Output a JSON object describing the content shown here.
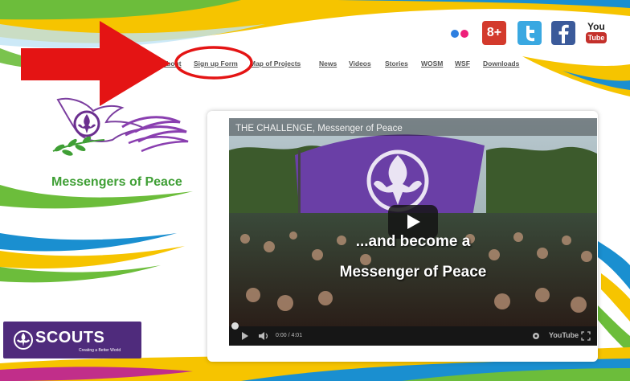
{
  "nav": {
    "items": [
      {
        "label": "About"
      },
      {
        "label": "Sign up Form"
      },
      {
        "label": "Map of Projects"
      },
      {
        "label": "News"
      },
      {
        "label": "Videos"
      },
      {
        "label": "Stories"
      },
      {
        "label": "WOSM"
      },
      {
        "label": "WSF"
      },
      {
        "label": "Downloads"
      }
    ]
  },
  "social": {
    "icons": [
      "flickr-icon",
      "google-plus-icon",
      "twitter-icon",
      "facebook-icon",
      "youtube-icon"
    ],
    "gplus_glyph": "8+",
    "youtube_top": "You",
    "youtube_bottom": "Tube"
  },
  "logo": {
    "text": "Messengers of Peace"
  },
  "scouts": {
    "word": "SCOUTS",
    "tagline": "Creating a Better World"
  },
  "video": {
    "title": "THE CHALLENGE, Messenger of Peace",
    "caption_line1": "...and become a",
    "caption_line2": "Messenger of Peace",
    "time": "0:00 / 4:01",
    "brand": "YouTube"
  },
  "colors": {
    "accent_red": "#e41414",
    "scout_purple": "#4f2b7c",
    "mop_green": "#3f9f35",
    "band_yellow": "#f6c400",
    "band_blue": "#1a8fd0",
    "band_green": "#6cbd3b",
    "band_magenta": "#c12e8a"
  }
}
